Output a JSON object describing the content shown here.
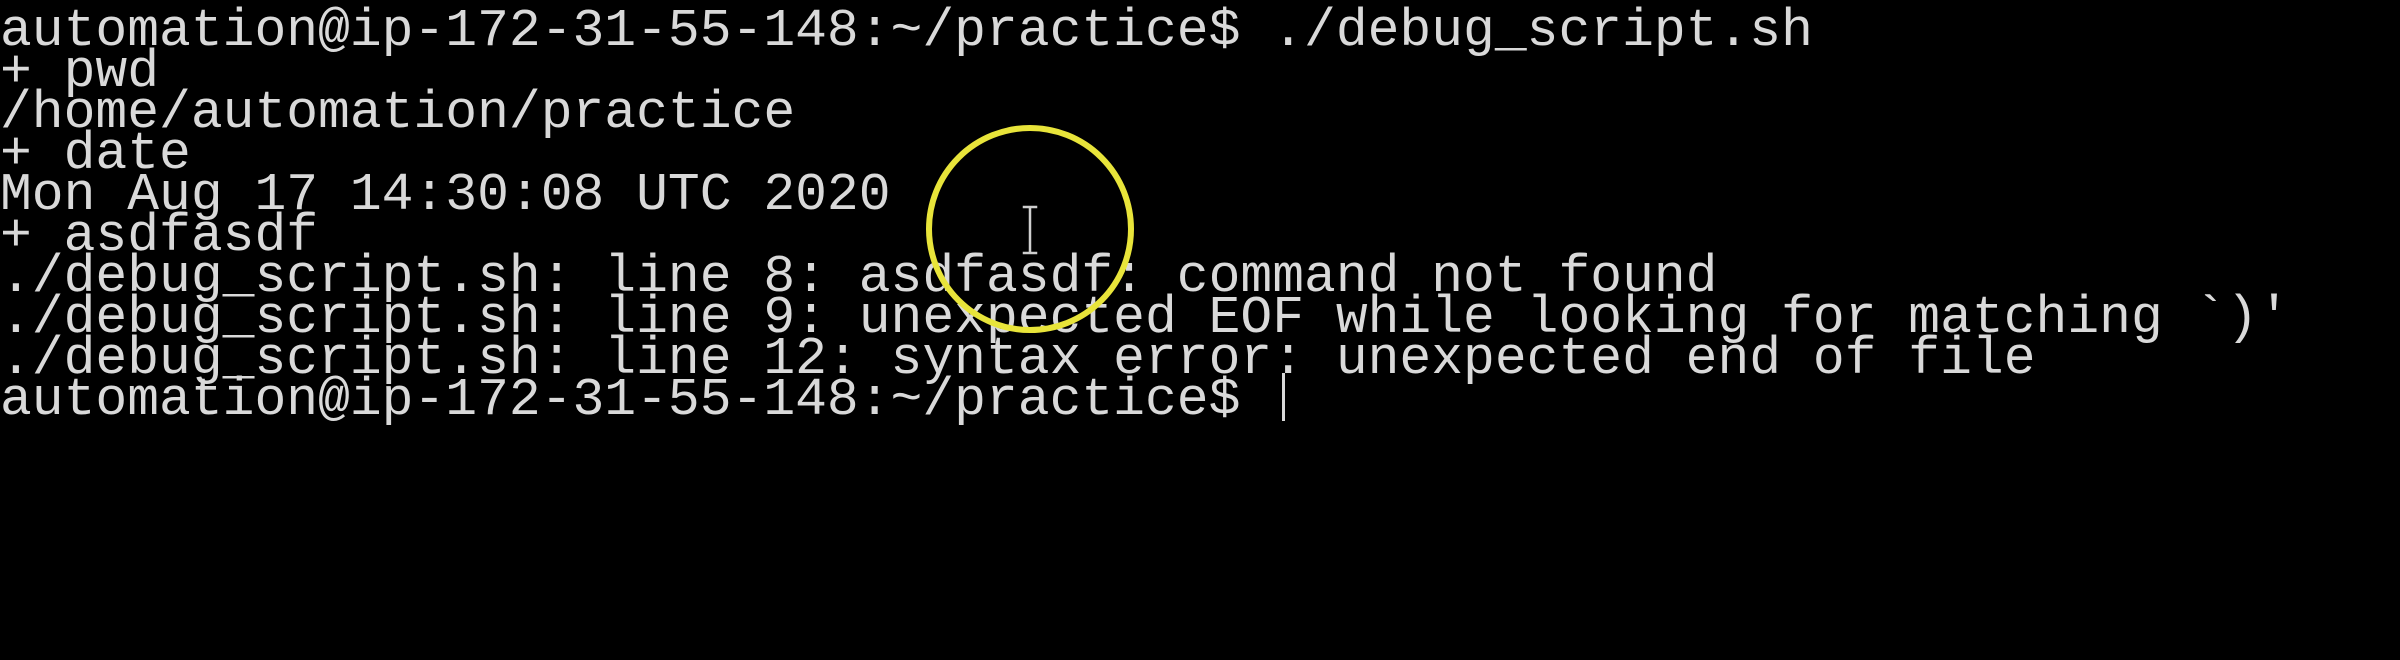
{
  "terminal": {
    "lines": [
      "automation@ip-172-31-55-148:~/practice$ ./debug_script.sh",
      "+ pwd",
      "/home/automation/practice",
      "+ date",
      "Mon Aug 17 14:30:08 UTC 2020",
      "+ asdfasdf",
      "./debug_script.sh: line 8: asdfasdf: command not found",
      "./debug_script.sh: line 9: unexpected EOF while looking for matching `)'",
      "./debug_script.sh: line 12: syntax error: unexpected end of file"
    ],
    "prompt": "automation@ip-172-31-55-148:~/practice$ "
  },
  "colors": {
    "background": "#000000",
    "text": "#d9d9d9",
    "highlight": "#e8e43a"
  },
  "icons": {
    "cursor": "i-beam-cursor-icon"
  }
}
